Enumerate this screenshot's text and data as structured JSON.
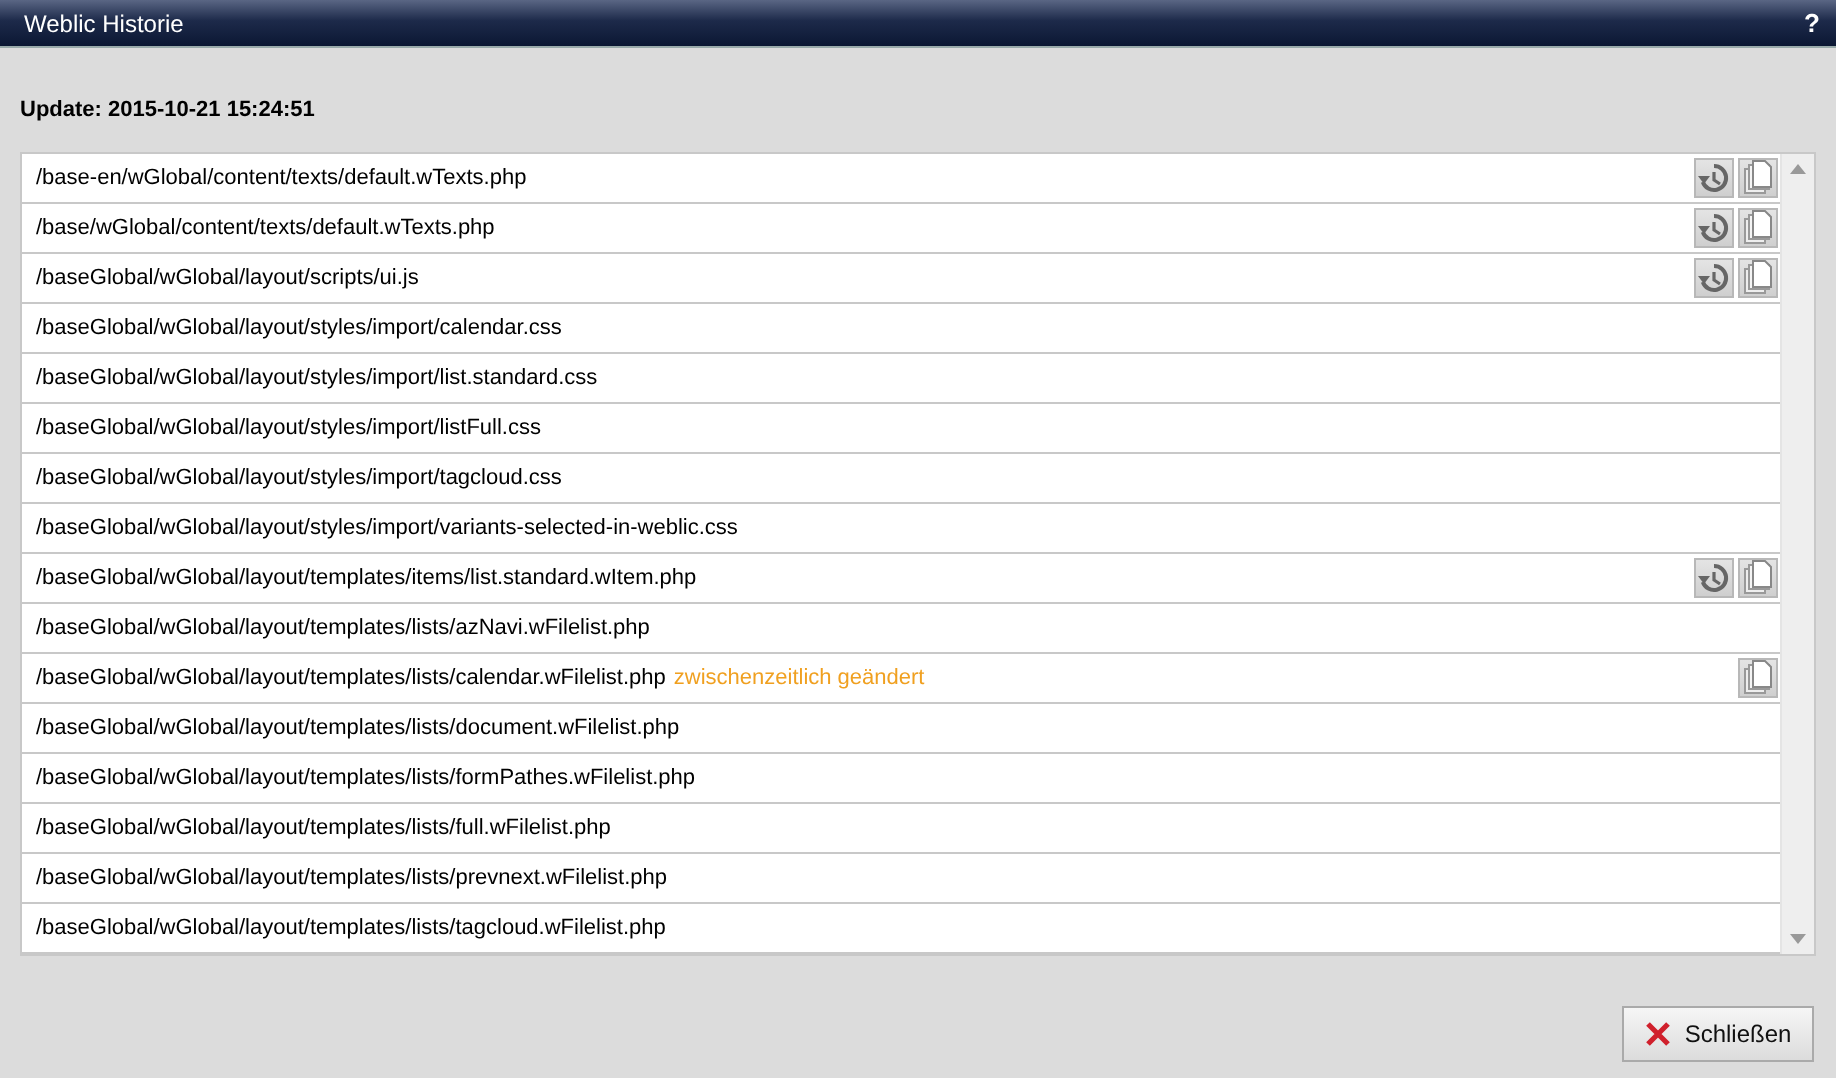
{
  "window": {
    "title": "Weblic Historie",
    "help": "?"
  },
  "update": "Update: 2015-10-21 15:24:51",
  "files": [
    {
      "path": "/base-en/wGlobal/content/texts/default.wTexts.php",
      "history": true,
      "copy": true
    },
    {
      "path": "/base/wGlobal/content/texts/default.wTexts.php",
      "history": true,
      "copy": true
    },
    {
      "path": "/baseGlobal/wGlobal/layout/scripts/ui.js",
      "history": true,
      "copy": true
    },
    {
      "path": "/baseGlobal/wGlobal/layout/styles/import/calendar.css",
      "history": false,
      "copy": false
    },
    {
      "path": "/baseGlobal/wGlobal/layout/styles/import/list.standard.css",
      "history": false,
      "copy": false
    },
    {
      "path": "/baseGlobal/wGlobal/layout/styles/import/listFull.css",
      "history": false,
      "copy": false
    },
    {
      "path": "/baseGlobal/wGlobal/layout/styles/import/tagcloud.css",
      "history": false,
      "copy": false
    },
    {
      "path": "/baseGlobal/wGlobal/layout/styles/import/variants-selected-in-weblic.css",
      "history": false,
      "copy": false
    },
    {
      "path": "/baseGlobal/wGlobal/layout/templates/items/list.standard.wItem.php",
      "history": true,
      "copy": true
    },
    {
      "path": "/baseGlobal/wGlobal/layout/templates/lists/azNavi.wFilelist.php",
      "history": false,
      "copy": false
    },
    {
      "path": "/baseGlobal/wGlobal/layout/templates/lists/calendar.wFilelist.php",
      "note": "zwischenzeitlich geändert",
      "history": false,
      "copy": true
    },
    {
      "path": "/baseGlobal/wGlobal/layout/templates/lists/document.wFilelist.php",
      "history": false,
      "copy": false
    },
    {
      "path": "/baseGlobal/wGlobal/layout/templates/lists/formPathes.wFilelist.php",
      "history": false,
      "copy": false
    },
    {
      "path": "/baseGlobal/wGlobal/layout/templates/lists/full.wFilelist.php",
      "history": false,
      "copy": false
    },
    {
      "path": "/baseGlobal/wGlobal/layout/templates/lists/prevnext.wFilelist.php",
      "history": false,
      "copy": false
    },
    {
      "path": "/baseGlobal/wGlobal/layout/templates/lists/tagcloud.wFilelist.php",
      "history": false,
      "copy": false
    }
  ],
  "buttons": [
    {
      "label": "Schließen"
    }
  ]
}
